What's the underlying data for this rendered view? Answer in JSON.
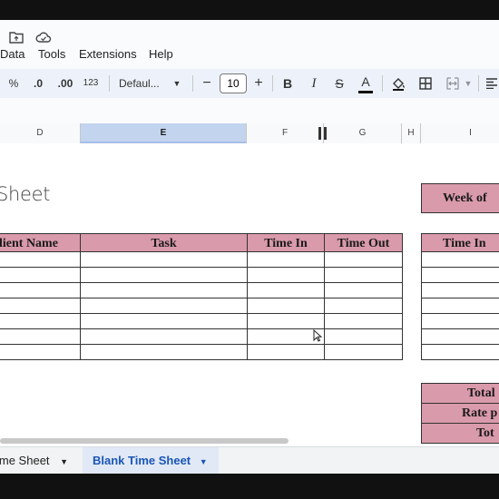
{
  "menu": {
    "items": [
      "Data",
      "Tools",
      "Extensions",
      "Help"
    ]
  },
  "toolbar": {
    "percent": "%",
    "dec_decrease": ".0",
    "dec_increase": ".00",
    "num_format": "123",
    "font_family": "Defaul...",
    "minus": "−",
    "font_size": "10",
    "plus": "+",
    "bold": "B",
    "italic": "I",
    "strike": "S",
    "text_color_letter": "A"
  },
  "columns": [
    "D",
    "E",
    "F",
    "G",
    "H",
    "I"
  ],
  "sheet": {
    "title": "Sheet",
    "headers": [
      "lient Name",
      "Task",
      "Time In",
      "Time Out"
    ],
    "right_headers": [
      "Time In"
    ],
    "week_label": "Week of",
    "summary_labels": [
      "Total",
      "Rate p",
      "Tot"
    ]
  },
  "tabs": {
    "prev_label": "ime Sheet",
    "active_label": "Blank Time Sheet"
  },
  "colors": {
    "header_fill": "#d99aab",
    "selected_column": "#c3d4ef",
    "active_tab_text": "#1a56b4"
  }
}
